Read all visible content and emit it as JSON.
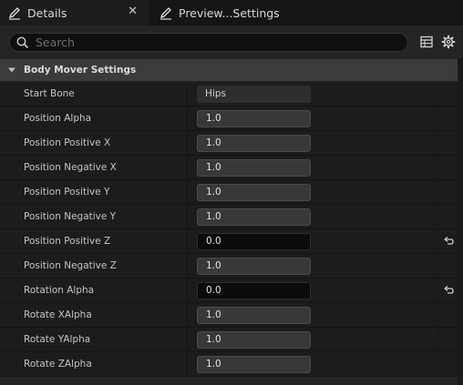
{
  "tabs": [
    {
      "label": "Details",
      "icon": "pencil-icon",
      "active": true
    },
    {
      "label": "Preview...Settings",
      "icon": "pencil-icon",
      "active": false
    }
  ],
  "tab_close": "✕",
  "search": {
    "placeholder": "Search",
    "value": ""
  },
  "category": {
    "label": "Body Mover Settings"
  },
  "properties": [
    {
      "name": "Start Bone",
      "value": "Hips",
      "kind": "combo",
      "reset": false
    },
    {
      "name": "Position Alpha",
      "value": "1.0",
      "kind": "number",
      "reset": false
    },
    {
      "name": "Position Positive X",
      "value": "1.0",
      "kind": "number",
      "reset": false
    },
    {
      "name": "Position Negative X",
      "value": "1.0",
      "kind": "number",
      "reset": false
    },
    {
      "name": "Position Positive Y",
      "value": "1.0",
      "kind": "number",
      "reset": false
    },
    {
      "name": "Position Negative Y",
      "value": "1.0",
      "kind": "number",
      "reset": false
    },
    {
      "name": "Position Positive Z",
      "value": "0.0",
      "kind": "number",
      "reset": true
    },
    {
      "name": "Position Negative Z",
      "value": "1.0",
      "kind": "number",
      "reset": false
    },
    {
      "name": "Rotation Alpha",
      "value": "0.0",
      "kind": "number",
      "reset": true
    },
    {
      "name": "Rotate XAlpha",
      "value": "1.0",
      "kind": "number",
      "reset": false
    },
    {
      "name": "Rotate YAlpha",
      "value": "1.0",
      "kind": "number",
      "reset": false
    },
    {
      "name": "Rotate ZAlpha",
      "value": "1.0",
      "kind": "number",
      "reset": false
    }
  ]
}
